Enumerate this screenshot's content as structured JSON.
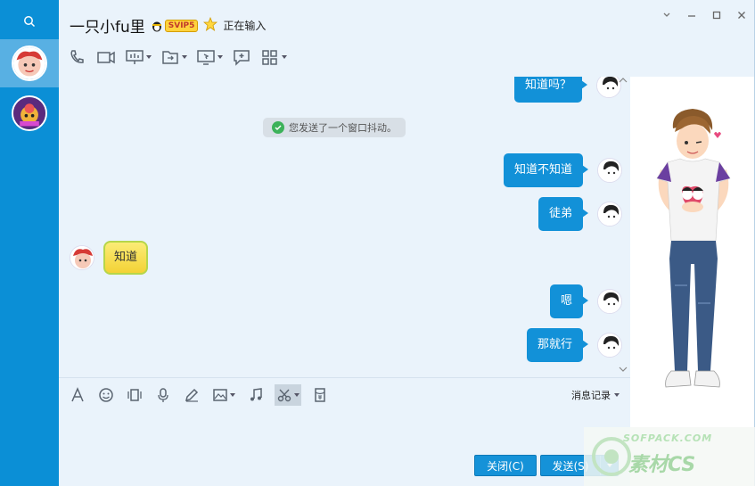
{
  "sidebar": {
    "search_icon": "search-icon",
    "contacts": [
      {
        "name": "contact-avatar-1",
        "active": true
      },
      {
        "name": "contact-avatar-2",
        "active": false
      }
    ]
  },
  "header": {
    "title": "一只小fu里",
    "vip_label": "SVIP5",
    "typing_status": "正在输入",
    "window_controls": [
      "chevron-down-icon",
      "minimize-icon",
      "maximize-icon",
      "close-icon"
    ]
  },
  "toolbar": {
    "buttons": [
      "phone-icon",
      "video-icon",
      "screen-share-icon",
      "transfer-icon",
      "remote-assist-icon",
      "new-chat-icon",
      "apps-icon"
    ]
  },
  "messages": {
    "m1": "知道吗？",
    "system_notice": "您发送了一个窗口抖动。",
    "m2": "知道不知道",
    "m3": "徒弟",
    "m4": "知道",
    "m5": "嗯",
    "m6": "那就行"
  },
  "input": {
    "tools": [
      "font-icon",
      "emoji-icon",
      "shake-icon",
      "voice-icon",
      "doodle-icon",
      "image-icon",
      "music-icon",
      "scissors-icon",
      "red-packet-icon"
    ],
    "history_label": "消息记录",
    "close_label": "关闭(C)",
    "send_label": "发送(S)"
  },
  "watermark": {
    "top": "SOFPACK.COM",
    "bottom": "素材CS"
  },
  "colors": {
    "sidebar": "#0b8fd6",
    "bubble_me": "#1291d8",
    "bubble_them": "#f3d235",
    "background": "#eaf3fb"
  }
}
